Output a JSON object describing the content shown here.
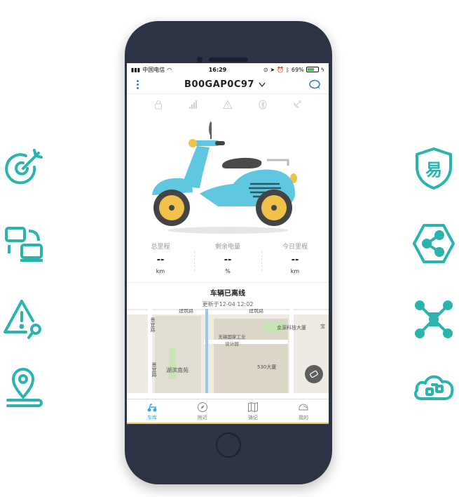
{
  "colors": {
    "teal": "#2ab4ad",
    "accent_blue": "#3aa9d8",
    "phone_body": "#2b3344"
  },
  "side_icons_left": [
    "target-icon",
    "devices-icon",
    "alert-search-icon",
    "location-pin-icon"
  ],
  "side_icons_right": [
    "shield-yi-icon",
    "share-hexagon-icon",
    "network-icon",
    "cloud-sync-icon"
  ],
  "shield_char": "易",
  "statusbar": {
    "carrier": "中国电信",
    "time": "16:29",
    "battery": "69%",
    "battery_level": 0.69
  },
  "navbar": {
    "title": "B00GAP0C97"
  },
  "status_icons": [
    "lock-icon",
    "signal-icon",
    "warning-icon",
    "bluetooth-icon",
    "satellite-icon"
  ],
  "stats": [
    {
      "label": "总里程",
      "value": "--",
      "unit": "km"
    },
    {
      "label": "剩余电量",
      "value": "--",
      "unit": "%"
    },
    {
      "label": "今日里程",
      "value": "--",
      "unit": "km"
    }
  ],
  "vehicle_status": {
    "title": "车辆已离线",
    "updated": "更新于12-04 12:02"
  },
  "map": {
    "labels": {
      "road_top": "建筑路",
      "road_top2": "建筑路",
      "jingyi_road": "景宜路",
      "jingyi_road2": "景宜路",
      "park": "湖滨南苑",
      "industrial": "无锡国家工业设计园",
      "building_530": "530大厦",
      "jinyuan": "金源科技大厦",
      "bao": "宝"
    }
  },
  "tabs": [
    {
      "label": "车库",
      "icon": "scooter-icon",
      "active": true
    },
    {
      "label": "附近",
      "icon": "compass-icon",
      "active": false
    },
    {
      "label": "骑记",
      "icon": "map-journal-icon",
      "active": false
    },
    {
      "label": "我的",
      "icon": "helmet-icon",
      "active": false
    }
  ]
}
